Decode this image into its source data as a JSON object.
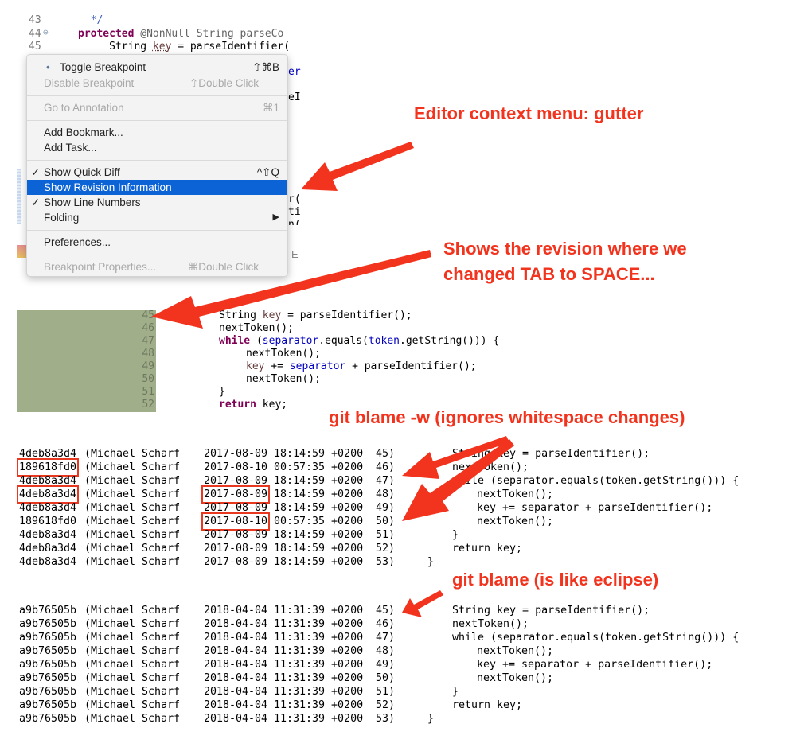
{
  "editor_top": {
    "lines": [
      {
        "num": "43",
        "code": "  */"
      },
      {
        "num": "44",
        "fold": "⊖",
        "code_kw": "protected",
        "code_rest": " @NonNull String parseCo"
      },
      {
        "num": "45",
        "code_a": "     String ",
        "code_var": "key",
        "code_b": " = parseIdentifier("
      }
    ],
    "right_fragments": [
      "er",
      "eI",
      "r(",
      "ti",
      "n("
    ],
    "status_fragment": "E"
  },
  "context_menu": {
    "items": [
      {
        "label": "Toggle Breakpoint",
        "shortcut": "⇧⌘B",
        "bullet": "•",
        "enabled": true
      },
      {
        "label": "Disable Breakpoint",
        "shortcut": "⇧Double Click",
        "enabled": false
      },
      {
        "label": "Go to Annotation",
        "shortcut": "⌘1",
        "enabled": false
      },
      {
        "label": "Add Bookmark...",
        "enabled": true
      },
      {
        "label": "Add Task...",
        "enabled": true
      },
      {
        "label": "Show Quick Diff",
        "shortcut": "^⇧Q",
        "checked": true,
        "check": "✓",
        "enabled": true
      },
      {
        "label": "Show Revision Information",
        "enabled": true,
        "selected": true
      },
      {
        "label": "Show Line Numbers",
        "checked": true,
        "check": "✓",
        "enabled": true
      },
      {
        "label": "Folding",
        "submenu": "▶",
        "enabled": true
      },
      {
        "label": "Preferences...",
        "enabled": true
      },
      {
        "label": "Breakpoint Properties...",
        "shortcut": "⌘Double Click",
        "enabled": false
      }
    ],
    "selected_color": "#0c63d6"
  },
  "annotations": {
    "gutter": "Editor context menu: gutter",
    "revision": "Shows the revision where we\nchanged TAB to SPACE...",
    "blame_w": "git blame -w (ignores whitespace changes)",
    "blame": "git blame (is like eclipse)",
    "color": "#f2331d"
  },
  "revision_view": {
    "gutter_color": "#a0ae8a",
    "line_numbers": [
      "45",
      "46",
      "47",
      "48",
      "49",
      "50",
      "51",
      "52"
    ]
  },
  "code_lines": [
    {
      "indent": 0,
      "parts": [
        [
          "",
          "String "
        ],
        [
          "var",
          "key"
        ],
        [
          "",
          " = parseIdentifier();"
        ]
      ]
    },
    {
      "indent": 0,
      "parts": [
        [
          "",
          "nextToken();"
        ]
      ]
    },
    {
      "indent": 0,
      "parts": [
        [
          "kw",
          "while"
        ],
        [
          "",
          " ("
        ],
        [
          "fld",
          "separator"
        ],
        [
          "",
          ".equals("
        ],
        [
          "fld",
          "token"
        ],
        [
          "",
          ".getString())) {"
        ]
      ]
    },
    {
      "indent": 1,
      "parts": [
        [
          "",
          "nextToken();"
        ]
      ]
    },
    {
      "indent": 1,
      "parts": [
        [
          "var",
          "key"
        ],
        [
          "",
          " += "
        ],
        [
          "fld",
          "separator"
        ],
        [
          "",
          " + parseIdentifier();"
        ]
      ]
    },
    {
      "indent": 1,
      "parts": [
        [
          "",
          "nextToken();"
        ]
      ]
    },
    {
      "indent": 0,
      "parts": [
        [
          "",
          "}"
        ]
      ]
    },
    {
      "indent": 0,
      "parts": [
        [
          "kw",
          "return"
        ],
        [
          "",
          " key;"
        ]
      ]
    }
  ],
  "blame_w": {
    "rows": [
      {
        "hash": "4deb8a3d4",
        "author": "(Michael Scharf",
        "date": "2017-08-09",
        "time": "18:14:59 +0200",
        "line": "45)",
        "code": "String key = parseIdentifier();",
        "indent": 0
      },
      {
        "hash": "189618fd0",
        "author": "(Michael Scharf",
        "date": "2017-08-10",
        "time": "00:57:35 +0200",
        "line": "46)",
        "code": "nextToken();",
        "indent": 0,
        "hash_boxed": true
      },
      {
        "hash": "4deb8a3d4",
        "author": "(Michael Scharf",
        "date": "2017-08-09",
        "time": "18:14:59 +0200",
        "line": "47)",
        "code": "while (separator.equals(token.getString())) {",
        "indent": 0
      },
      {
        "hash": "4deb8a3d4",
        "author": "(Michael Scharf",
        "date": "2017-08-09",
        "time": "18:14:59 +0200",
        "line": "48)",
        "code": "nextToken();",
        "indent": 1,
        "hash_boxed": true,
        "date_boxed": true
      },
      {
        "hash": "4deb8a3d4",
        "author": "(Michael Scharf",
        "date": "2017-08-09",
        "time": "18:14:59 +0200",
        "line": "49)",
        "code": "key += separator + parseIdentifier();",
        "indent": 1
      },
      {
        "hash": "189618fd0",
        "author": "(Michael Scharf",
        "date": "2017-08-10",
        "time": "00:57:35 +0200",
        "line": "50)",
        "code": "nextToken();",
        "indent": 1,
        "date_boxed": true
      },
      {
        "hash": "4deb8a3d4",
        "author": "(Michael Scharf",
        "date": "2017-08-09",
        "time": "18:14:59 +0200",
        "line": "51)",
        "code": "}",
        "indent": 0
      },
      {
        "hash": "4deb8a3d4",
        "author": "(Michael Scharf",
        "date": "2017-08-09",
        "time": "18:14:59 +0200",
        "line": "52)",
        "code": "return key;",
        "indent": 0
      },
      {
        "hash": "4deb8a3d4",
        "author": "(Michael Scharf",
        "date": "2017-08-09",
        "time": "18:14:59 +0200",
        "line": "53)",
        "code": "}",
        "indent": -1
      }
    ]
  },
  "blame": {
    "rows": [
      {
        "hash": "a9b76505b",
        "author": "(Michael Scharf",
        "date": "2018-04-04",
        "time": "11:31:39 +0200",
        "line": "45)",
        "code": "String key = parseIdentifier();",
        "indent": 0
      },
      {
        "hash": "a9b76505b",
        "author": "(Michael Scharf",
        "date": "2018-04-04",
        "time": "11:31:39 +0200",
        "line": "46)",
        "code": "nextToken();",
        "indent": 0
      },
      {
        "hash": "a9b76505b",
        "author": "(Michael Scharf",
        "date": "2018-04-04",
        "time": "11:31:39 +0200",
        "line": "47)",
        "code": "while (separator.equals(token.getString())) {",
        "indent": 0
      },
      {
        "hash": "a9b76505b",
        "author": "(Michael Scharf",
        "date": "2018-04-04",
        "time": "11:31:39 +0200",
        "line": "48)",
        "code": "nextToken();",
        "indent": 1
      },
      {
        "hash": "a9b76505b",
        "author": "(Michael Scharf",
        "date": "2018-04-04",
        "time": "11:31:39 +0200",
        "line": "49)",
        "code": "key += separator + parseIdentifier();",
        "indent": 1
      },
      {
        "hash": "a9b76505b",
        "author": "(Michael Scharf",
        "date": "2018-04-04",
        "time": "11:31:39 +0200",
        "line": "50)",
        "code": "nextToken();",
        "indent": 1
      },
      {
        "hash": "a9b76505b",
        "author": "(Michael Scharf",
        "date": "2018-04-04",
        "time": "11:31:39 +0200",
        "line": "51)",
        "code": "}",
        "indent": 0
      },
      {
        "hash": "a9b76505b",
        "author": "(Michael Scharf",
        "date": "2018-04-04",
        "time": "11:31:39 +0200",
        "line": "52)",
        "code": "return key;",
        "indent": 0
      },
      {
        "hash": "a9b76505b",
        "author": "(Michael Scharf",
        "date": "2018-04-04",
        "time": "11:31:39 +0200",
        "line": "53)",
        "code": "}",
        "indent": -1
      }
    ]
  }
}
